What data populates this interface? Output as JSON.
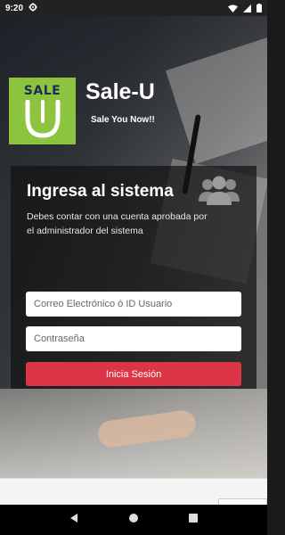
{
  "status_bar": {
    "time": "9:20",
    "icons": [
      "settings-gear-icon",
      "wifi-icon",
      "signal-icon",
      "battery-icon"
    ]
  },
  "app": {
    "logo_text": "SALE",
    "title": "Sale-U",
    "tagline": "Sale You Now!!"
  },
  "login": {
    "heading": "Ingresa al sistema",
    "description": "Debes contar con una cuenta aprobada por el administrador del sistema",
    "email_placeholder": "Correo Electrónico ó ID Usuario",
    "password_placeholder": "Contraseña",
    "submit_label": "Inicia Sesión"
  },
  "colors": {
    "brand_green": "#8cc43f",
    "logo_navy": "#1f2a55",
    "button_red": "#dc3545",
    "panel_bg": "rgba(18,18,18,0.72)"
  },
  "nav_bar": {
    "icons": [
      "back-icon",
      "home-icon",
      "recents-icon"
    ]
  }
}
